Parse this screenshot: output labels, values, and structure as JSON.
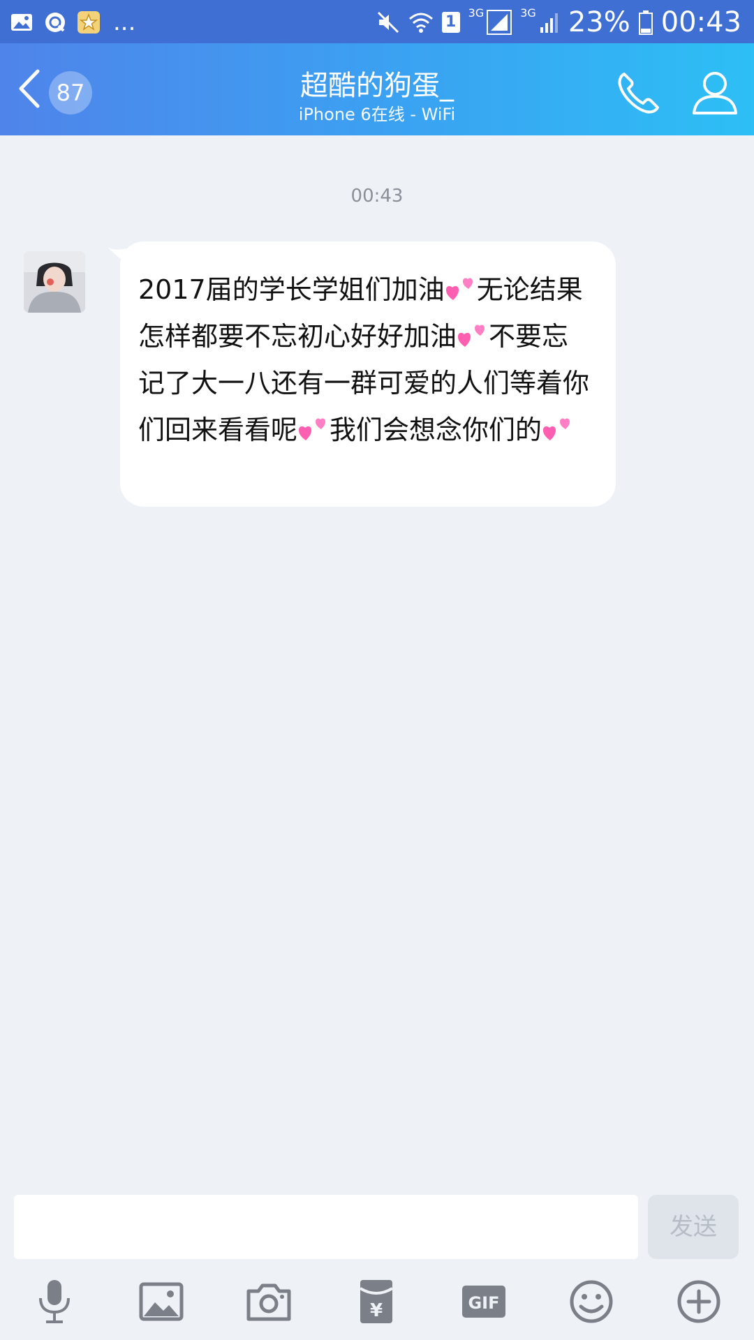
{
  "status_bar": {
    "more": "...",
    "sim_slot": "1",
    "net_1": "3G",
    "net_2": "3G",
    "battery": "23%",
    "time": "00:43"
  },
  "header": {
    "unread_count": "87",
    "title": "超酷的狗蛋_",
    "subtitle": "iPhone 6在线 - WiFi",
    "gradient_start": "#4f84ea",
    "gradient_end": "#2dbff5"
  },
  "chat": {
    "timestamp": "00:43",
    "message": {
      "segments": [
        "2017届的学长学姐们加油",
        "无论结果怎样都要不忘初心好好加油",
        "不要忘记了大一八还有一群可爱的人们等着你们回来看看呢",
        "我们会想念你们的"
      ]
    }
  },
  "input": {
    "value": "",
    "send_label": "发送"
  },
  "toolbar": {
    "gif_label": "GIF",
    "red_packet_symbol": "¥"
  },
  "colors": {
    "accent": "#3aa3f2",
    "background": "#eef1f6",
    "icon_gray": "#7b7f87"
  }
}
